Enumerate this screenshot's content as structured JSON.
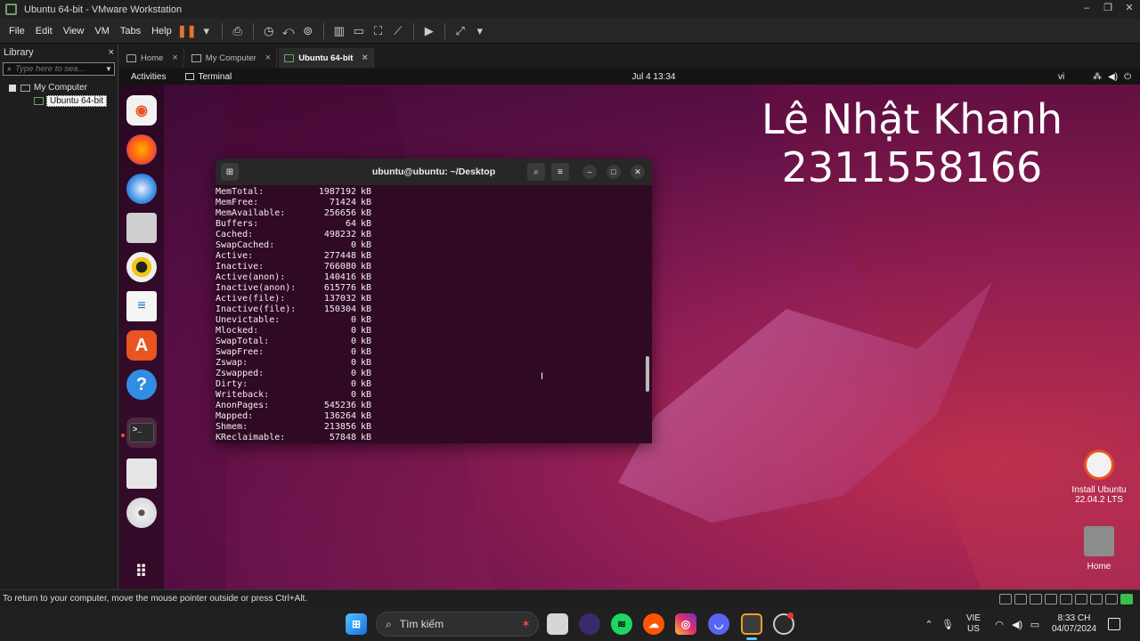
{
  "window": {
    "title": "Ubuntu 64-bit - VMware Workstation",
    "controls": [
      "–",
      "❐",
      "✕"
    ]
  },
  "menu": [
    "File",
    "Edit",
    "View",
    "VM",
    "Tabs",
    "Help"
  ],
  "library": {
    "title": "Library",
    "close": "×",
    "search_placeholder": "Type here to sea...",
    "tree": {
      "root": "My Computer",
      "selected": "Ubuntu 64-bit"
    }
  },
  "tabs": [
    {
      "label": "Home"
    },
    {
      "label": "My Computer"
    },
    {
      "label": "Ubuntu 64-bit",
      "active": true
    }
  ],
  "ubuntu": {
    "topbar": {
      "activities": "Activities",
      "app": "Terminal",
      "clock": "Jul 4  13:34",
      "lang": "vi"
    },
    "watermark": {
      "line1": "Lê Nhật Khanh",
      "line2": "2311558166"
    },
    "desktop_icons": [
      {
        "label": "Install Ubuntu 22.04.2 LTS"
      },
      {
        "label": "Home"
      }
    ],
    "terminal": {
      "title": "ubuntu@ubuntu: ~/Desktop",
      "rows": [
        {
          "k": "MemTotal:",
          "v": "1987192",
          "u": "kB"
        },
        {
          "k": "MemFree:",
          "v": "71424",
          "u": "kB"
        },
        {
          "k": "MemAvailable:",
          "v": "256656",
          "u": "kB"
        },
        {
          "k": "Buffers:",
          "v": "64",
          "u": "kB"
        },
        {
          "k": "Cached:",
          "v": "498232",
          "u": "kB"
        },
        {
          "k": "SwapCached:",
          "v": "0",
          "u": "kB"
        },
        {
          "k": "Active:",
          "v": "277448",
          "u": "kB"
        },
        {
          "k": "Inactive:",
          "v": "766080",
          "u": "kB"
        },
        {
          "k": "Active(anon):",
          "v": "140416",
          "u": "kB"
        },
        {
          "k": "Inactive(anon):",
          "v": "615776",
          "u": "kB"
        },
        {
          "k": "Active(file):",
          "v": "137032",
          "u": "kB"
        },
        {
          "k": "Inactive(file):",
          "v": "150304",
          "u": "kB"
        },
        {
          "k": "Unevictable:",
          "v": "0",
          "u": "kB"
        },
        {
          "k": "Mlocked:",
          "v": "0",
          "u": "kB"
        },
        {
          "k": "SwapTotal:",
          "v": "0",
          "u": "kB"
        },
        {
          "k": "SwapFree:",
          "v": "0",
          "u": "kB"
        },
        {
          "k": "Zswap:",
          "v": "0",
          "u": "kB"
        },
        {
          "k": "Zswapped:",
          "v": "0",
          "u": "kB"
        },
        {
          "k": "Dirty:",
          "v": "0",
          "u": "kB"
        },
        {
          "k": "Writeback:",
          "v": "0",
          "u": "kB"
        },
        {
          "k": "AnonPages:",
          "v": "545236",
          "u": "kB"
        },
        {
          "k": "Mapped:",
          "v": "136264",
          "u": "kB"
        },
        {
          "k": "Shmem:",
          "v": "213856",
          "u": "kB"
        },
        {
          "k": "KReclaimable:",
          "v": "57848",
          "u": "kB"
        }
      ]
    }
  },
  "status": {
    "text": "To return to your computer, move the mouse pointer outside or press Ctrl+Alt."
  },
  "taskbar": {
    "search": "Tìm kiếm",
    "lang": {
      "line1": "VIE",
      "line2": "US"
    },
    "time": "8:33 CH",
    "date": "04/07/2024"
  },
  "colors": {
    "ubuntu_orange": "#e95420",
    "terminal_bg": "#300a24",
    "vm_accent": "#6fa06a"
  }
}
